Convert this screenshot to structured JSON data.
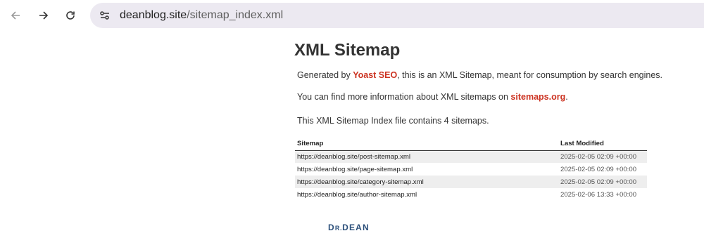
{
  "browser": {
    "url_host": "deanblog.site",
    "url_path": "/sitemap_index.xml"
  },
  "page": {
    "title": "XML Sitemap",
    "intro_prefix": "Generated by ",
    "intro_link": "Yoast SEO",
    "intro_suffix": ", this is an XML Sitemap, meant for consumption by search engines.",
    "info_prefix": "You can find more information about XML sitemaps on ",
    "info_link": "sitemaps.org",
    "info_suffix": ".",
    "count_text": "This XML Sitemap Index file contains 4 sitemaps."
  },
  "table": {
    "headers": [
      "Sitemap",
      "Last Modified"
    ],
    "rows": [
      {
        "url": "https://deanblog.site/post-sitemap.xml",
        "modified": "2025-02-05 02:09 +00:00"
      },
      {
        "url": "https://deanblog.site/page-sitemap.xml",
        "modified": "2025-02-05 02:09 +00:00"
      },
      {
        "url": "https://deanblog.site/category-sitemap.xml",
        "modified": "2025-02-05 02:09 +00:00"
      },
      {
        "url": "https://deanblog.site/author-sitemap.xml",
        "modified": "2025-02-06 13:33 +00:00"
      }
    ]
  },
  "logo": {
    "first": "D",
    "middle": "R.",
    "last": "DEAN"
  },
  "icons": {
    "back": "arrow-left-icon",
    "forward": "arrow-right-icon",
    "reload": "reload-icon",
    "site_info": "tune-icon"
  },
  "colors": {
    "link": "#cc3322",
    "omnibox": "#ece9f1",
    "logo": "#2b4f7a"
  }
}
